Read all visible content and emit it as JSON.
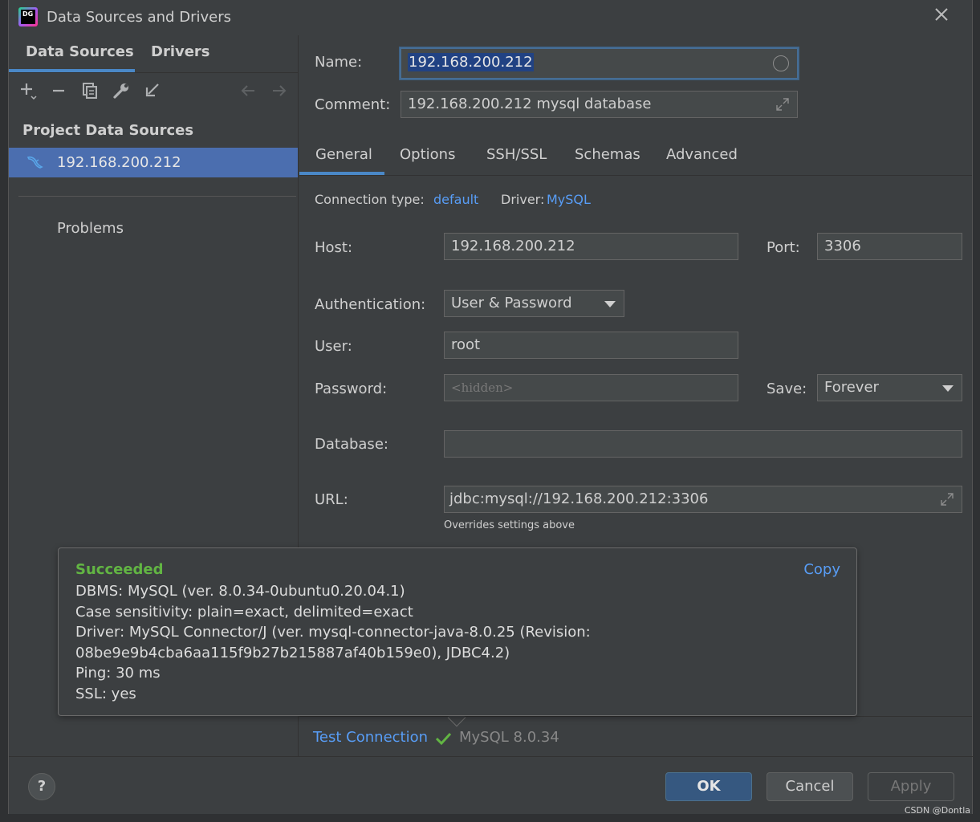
{
  "window": {
    "title": "Data Sources and Drivers",
    "icon_text": "DG"
  },
  "left": {
    "tabs": [
      "Data Sources",
      "Drivers"
    ],
    "toolbar_icons": [
      "add-icon",
      "remove-icon",
      "copy-icon",
      "wrench-icon",
      "import-icon",
      "back-arrow-icon",
      "forward-arrow-icon"
    ],
    "section_title": "Project Data Sources",
    "selected_item": "192.168.200.212",
    "problems": "Problems"
  },
  "form": {
    "name_label": "Name:",
    "name_value": "192.168.200.212",
    "comment_label": "Comment:",
    "comment_value": "192.168.200.212 mysql database",
    "tabs": [
      "General",
      "Options",
      "SSH/SSL",
      "Schemas",
      "Advanced"
    ],
    "connection_type_label": "Connection type:",
    "connection_type_value": "default",
    "driver_label": "Driver:",
    "driver_value": "MySQL",
    "host_label": "Host:",
    "host_value": "192.168.200.212",
    "port_label": "Port:",
    "port_value": "3306",
    "auth_label": "Authentication:",
    "auth_value": "User & Password",
    "user_label": "User:",
    "user_value": "root",
    "password_label": "Password:",
    "password_placeholder": "<hidden>",
    "save_label": "Save:",
    "save_value": "Forever",
    "database_label": "Database:",
    "database_value": "",
    "url_label": "URL:",
    "url_value": "jdbc:mysql://192.168.200.212:3306",
    "url_hint": "Overrides settings above"
  },
  "popup": {
    "status": "Succeeded",
    "copy": "Copy",
    "lines": [
      "DBMS: MySQL (ver. 8.0.34-0ubuntu0.20.04.1)",
      "Case sensitivity: plain=exact, delimited=exact",
      "Driver: MySQL Connector/J (ver. mysql-connector-java-8.0.25 (Revision:",
      "08be9e9b4cba6aa115f9b27b215887af40b159e0), JDBC4.2)",
      "Ping: 30 ms",
      "SSL: yes"
    ]
  },
  "test": {
    "link": "Test Connection",
    "version": "MySQL 8.0.34"
  },
  "footer": {
    "help": "?",
    "ok": "OK",
    "cancel": "Cancel",
    "apply": "Apply",
    "watermark": "CSDN @Dontla"
  },
  "colors": {
    "accent": "#4a88c7",
    "selection": "#4b6eaf",
    "link": "#589df6",
    "success": "#62b543"
  }
}
